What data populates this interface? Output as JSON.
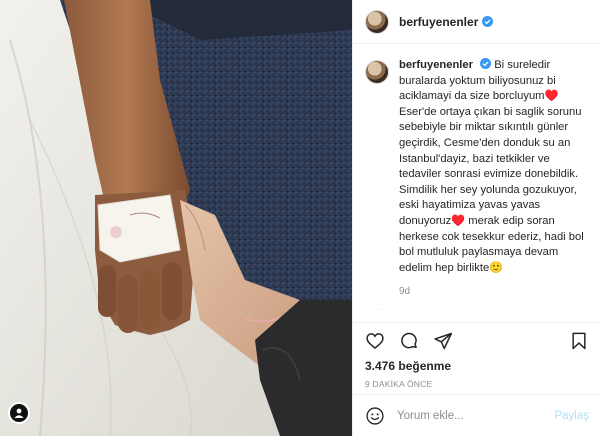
{
  "post": {
    "username": "berfuyenenler",
    "verified": true,
    "accent_color": "#3897f0",
    "caption": "Bi sureledir buralarda yoktum biliyosunuz bi aciklamayi da size borcluyum♥️ Eser'de ortaya çıkan bi saglik sorunu sebebiyle bir miktar sıkıntılı günler geçirdik, Cesme'den donduk su an Istanbul'dayiz, bazi tetkikler ve tedaviler sonrasi evimize donebildik. Simdilik her sey yolunda gozukuyor, eski hayatimiza yavas yavas donuyoruz♥️ merak edip soran herkese cok tesekkur ederiz, hadi bol bol mutluluk paylasmaya devam edelim hep birlikte🙂",
    "caption_time": "9d",
    "likes_count": "3.476",
    "likes_suffix": "beğenme",
    "time_ago": "9 DAKİKA ÖNCE"
  },
  "icons": {
    "like": "heart-icon",
    "comment": "comment-icon",
    "share": "paper-plane-icon",
    "save": "bookmark-icon",
    "emoji": "smiley-icon",
    "photo_tag": "person-icon"
  },
  "comment_box": {
    "placeholder": "Yorum ekle...",
    "post_label": "Paylaş"
  }
}
